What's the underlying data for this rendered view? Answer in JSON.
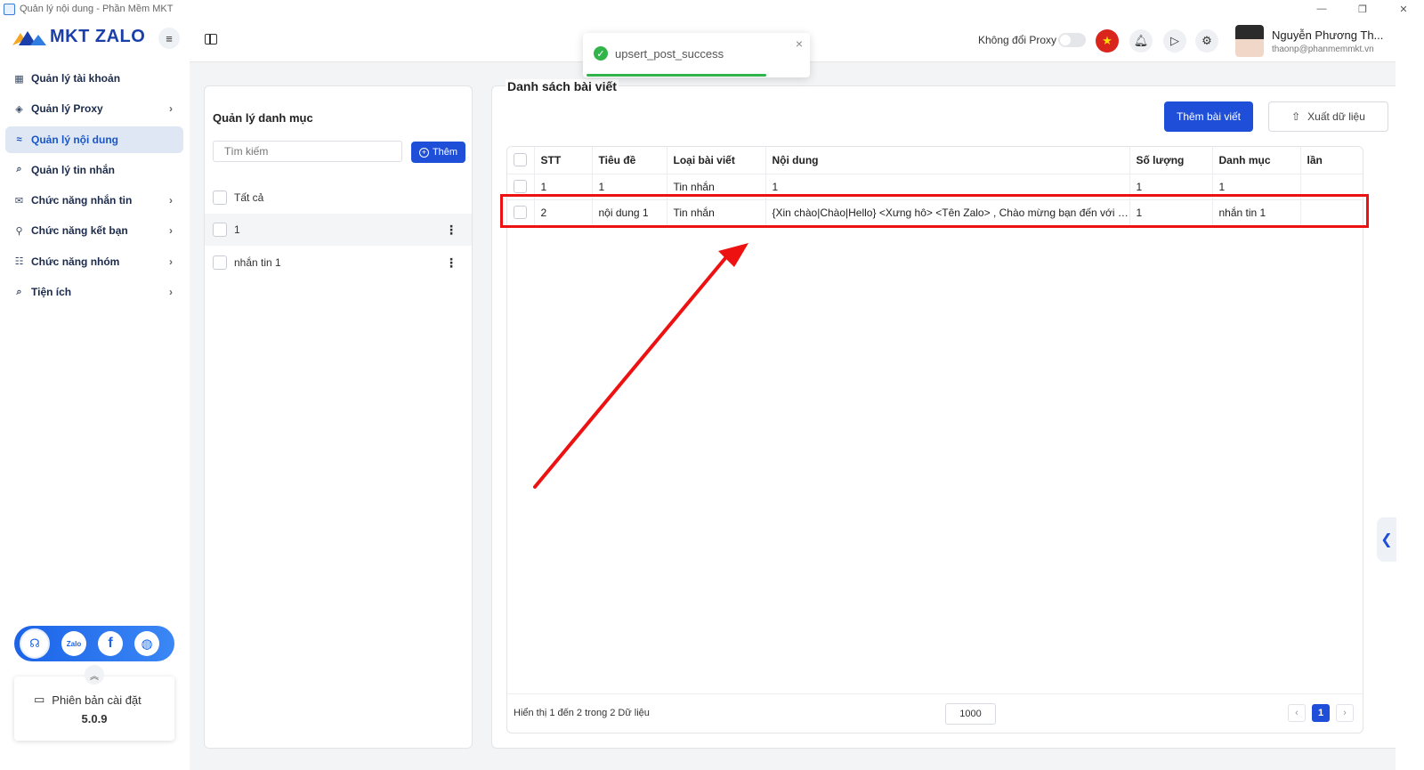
{
  "window": {
    "title": "Quản lý nội dung - Phần Mềm MKT",
    "minimize": "—",
    "maximize": "❐",
    "close": "✕"
  },
  "brand": {
    "name": "MKT ZALO",
    "menu_icon": "≡"
  },
  "sidebar": {
    "items": [
      {
        "label": "Quản lý tài khoản",
        "icon": "grid-icon",
        "has_chevron": false
      },
      {
        "label": "Quản lý Proxy",
        "icon": "layers-icon",
        "has_chevron": true
      },
      {
        "label": "Quản lý nội dung",
        "icon": "edit-lines-icon",
        "has_chevron": false,
        "active": true
      },
      {
        "label": "Quản lý tin nhắn",
        "icon": "search-message-icon",
        "has_chevron": false
      },
      {
        "label": "Chức năng nhắn tin",
        "icon": "chat-icon",
        "has_chevron": true
      },
      {
        "label": "Chức năng kết bạn",
        "icon": "add-user-icon",
        "has_chevron": true
      },
      {
        "label": "Chức năng nhóm",
        "icon": "group-icon",
        "has_chevron": true
      },
      {
        "label": "Tiện ích",
        "icon": "utility-icon",
        "has_chevron": true
      }
    ],
    "social": {
      "zalo_label": "Zalo",
      "facebook_label": "f"
    },
    "version": {
      "label": "Phiên bản cài đặt",
      "number": "5.0.9"
    }
  },
  "header": {
    "proxy_label": "Không đổi Proxy",
    "proxy_enabled": false,
    "user": {
      "name": "Nguyễn Phương Th...",
      "email": "thaonp@phanmemmkt.vn"
    }
  },
  "toast": {
    "message": "upsert_post_success",
    "progress": 0.8
  },
  "categories": {
    "title": "Quản lý danh mục",
    "search_placeholder": "Tìm kiếm",
    "add_label": "Thêm",
    "all_label": "Tất cả",
    "items": [
      {
        "label": "1",
        "highlighted": true
      },
      {
        "label": "nhắn tin 1",
        "highlighted": false
      }
    ]
  },
  "posts": {
    "title": "Danh sách bài viết",
    "add_label": "Thêm bài viết",
    "export_label": "Xuất dữ liệu",
    "columns": [
      "STT",
      "Tiêu đề",
      "Loại bài viết",
      "Nội dung",
      "Số lượng",
      "Danh mục",
      "lần"
    ],
    "rows": [
      [
        "1",
        "1",
        "Tin nhắn",
        "1",
        "1",
        "1",
        ""
      ],
      [
        "2",
        "nội dung 1",
        "Tin nhắn",
        "{Xin chào|Chào|Hello} <Xưng hô> <Tên Zalo> , Chào mừng bạn đến với Ph...",
        "1",
        "nhắn tin 1",
        ""
      ]
    ],
    "footer_info": "Hiển thị 1 đến 2 trong 2 Dữ liệu",
    "page_size": "1000",
    "current_page": "1",
    "prev": "‹",
    "next": "›"
  },
  "colors": {
    "accent": "#1f4fd8",
    "highlight": "#ee1111",
    "success": "#31b54a"
  }
}
